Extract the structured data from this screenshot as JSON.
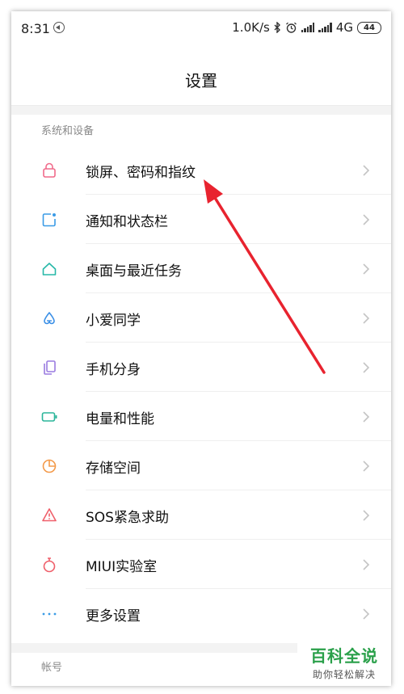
{
  "status_bar": {
    "time": "8:31",
    "network_speed": "1.0K/s",
    "network_type": "4G",
    "network_sub": "ill",
    "battery": "44",
    "icons": [
      "navigation-icon",
      "bluetooth-icon",
      "alarm-icon",
      "signal-icon",
      "signal-icon",
      "battery-icon"
    ]
  },
  "header": {
    "title": "设置"
  },
  "sections": {
    "system_label": "系统和设备",
    "account_label": "帐号"
  },
  "items": [
    {
      "label": "锁屏、密码和指纹",
      "icon": "lock-icon",
      "color": "#f06a8a"
    },
    {
      "label": "通知和状态栏",
      "icon": "notification-icon",
      "color": "#3a9be6"
    },
    {
      "label": "桌面与最近任务",
      "icon": "home-icon",
      "color": "#27b8a8"
    },
    {
      "label": "小爱同学",
      "icon": "xiaoai-icon",
      "color": "#3a8fe6"
    },
    {
      "label": "手机分身",
      "icon": "dual-phone-icon",
      "color": "#9a7be0"
    },
    {
      "label": "电量和性能",
      "icon": "battery-icon",
      "color": "#2bb59a"
    },
    {
      "label": "存储空间",
      "icon": "storage-pie-icon",
      "color": "#f39a4a"
    },
    {
      "label": "SOS紧急求助",
      "icon": "sos-icon",
      "color": "#ef5f6a"
    },
    {
      "label": "MIUI实验室",
      "icon": "lab-flask-icon",
      "color": "#ef5f6a"
    },
    {
      "label": "更多设置",
      "icon": "more-dots-icon",
      "color": "#3a9be6"
    }
  ],
  "watermark": {
    "main": "百科全说",
    "sub": "助你轻松解决"
  },
  "colors": {
    "annotation_arrow": "#e8232f",
    "chevron": "#c4c4c4"
  }
}
